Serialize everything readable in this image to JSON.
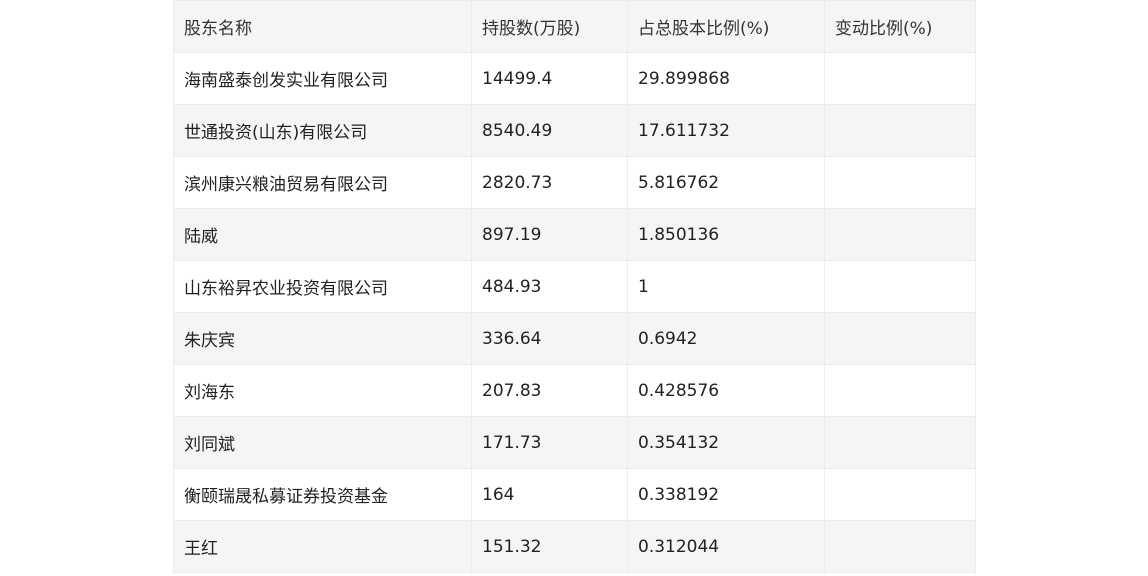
{
  "table": {
    "headers": [
      "股东名称",
      "持股数(万股)",
      "占总股本比例(%)",
      "变动比例(%)"
    ],
    "rows": [
      [
        "海南盛泰创发实业有限公司",
        "14499.4",
        "29.899868",
        ""
      ],
      [
        "世通投资(山东)有限公司",
        "8540.49",
        "17.611732",
        ""
      ],
      [
        "滨州康兴粮油贸易有限公司",
        "2820.73",
        "5.816762",
        ""
      ],
      [
        "陆威",
        "897.19",
        "1.850136",
        ""
      ],
      [
        "山东裕昇农业投资有限公司",
        "484.93",
        "1",
        ""
      ],
      [
        "朱庆宾",
        "336.64",
        "0.6942",
        ""
      ],
      [
        "刘海东",
        "207.83",
        "0.428576",
        ""
      ],
      [
        "刘同斌",
        "171.73",
        "0.354132",
        ""
      ],
      [
        "衡颐瑞晟私募证券投资基金",
        "164",
        "0.338192",
        ""
      ],
      [
        "王红",
        "151.32",
        "0.312044",
        ""
      ]
    ]
  },
  "colors": {
    "header_bg": "#f5f5f5",
    "stripe_bg": "#f5f5f5",
    "border": "#ececec",
    "text": "#222222"
  }
}
